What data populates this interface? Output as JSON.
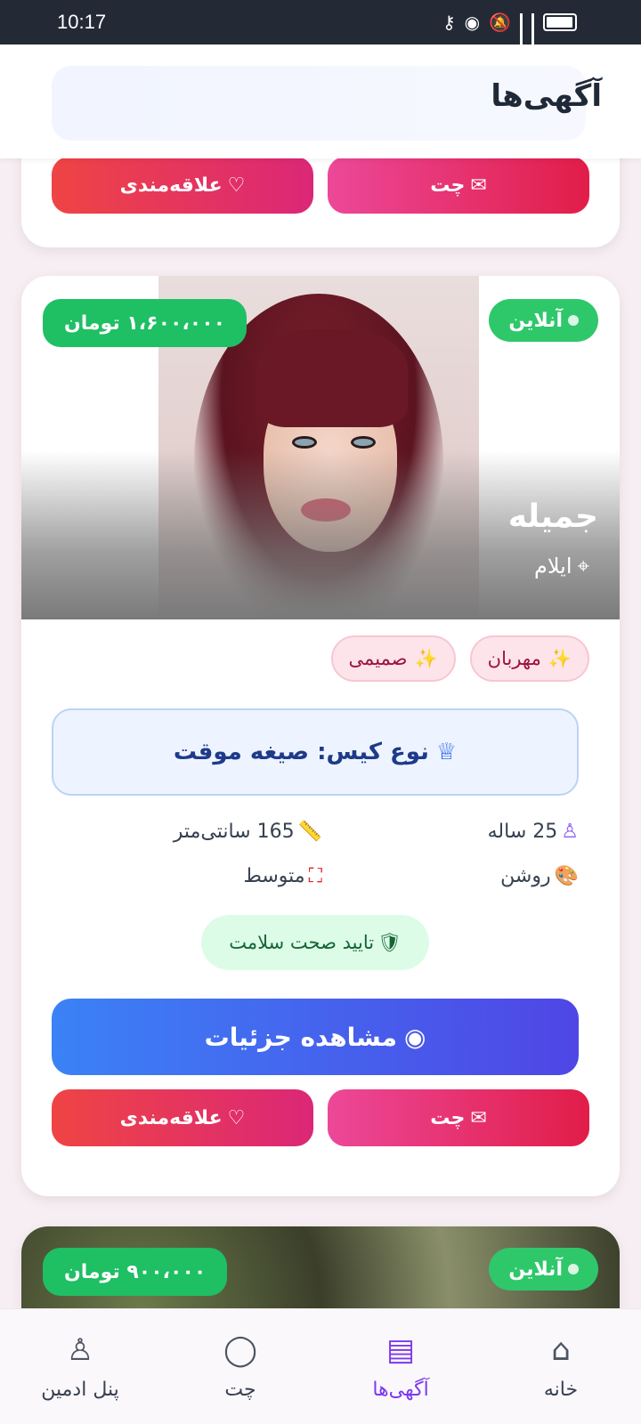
{
  "status": {
    "time": "10:17"
  },
  "header": {
    "title": "آگهی‌ها"
  },
  "top_card": {
    "chat_label": "چت",
    "fav_label": "علاقه‌مندی"
  },
  "main_card": {
    "status": "آنلاین",
    "price": "۱،۶۰۰،۰۰۰ تومان",
    "name": "جمیله",
    "city": "ایلام",
    "tags": [
      "مهربان",
      "صمیمی"
    ],
    "case_type": "نوع کیس: صیغه موقت",
    "age": "25 ساله",
    "height": "165 سانتی‌متر",
    "skin": "روشن",
    "body": "متوسط",
    "health": "تایید صحت سلامت",
    "details_label": "مشاهده جزئیات",
    "chat_label": "چت",
    "fav_label": "علاقه‌مندی"
  },
  "next_card": {
    "status": "آنلاین",
    "price": "۹۰۰،۰۰۰ تومان"
  },
  "nav": [
    {
      "label": "خانه",
      "icon": "home-icon"
    },
    {
      "label": "آگهی‌ها",
      "icon": "ads-icon",
      "active": true
    },
    {
      "label": "چت",
      "icon": "chat-bubble-icon"
    },
    {
      "label": "پنل ادمین",
      "icon": "admin-user-icon"
    }
  ],
  "colors": {
    "accent": "#7c3aed",
    "online": "#2ec86b",
    "primary": "#3b82f6",
    "danger": "#ef4444"
  }
}
